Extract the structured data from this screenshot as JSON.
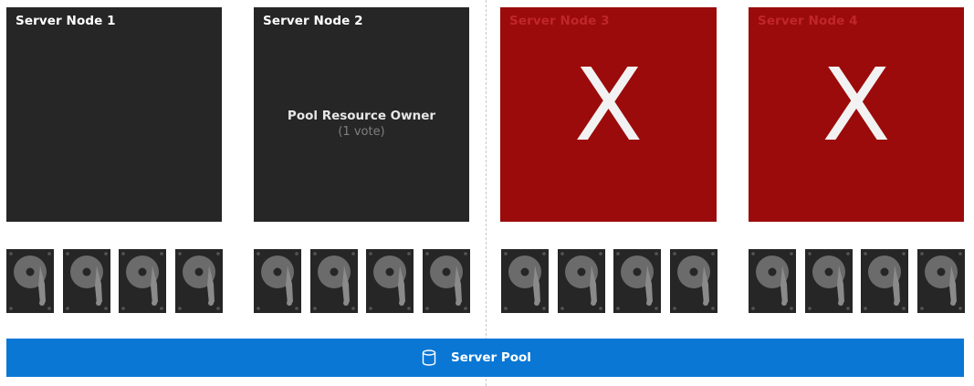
{
  "nodes": [
    {
      "title": "Server Node 1",
      "status": "online"
    },
    {
      "title": "Server Node 2",
      "status": "online",
      "role": "Pool Resource Owner",
      "votes": "(1 vote)"
    },
    {
      "title": "Server Node 3",
      "status": "failed",
      "mark": "X"
    },
    {
      "title": "Server Node 4",
      "status": "failed",
      "mark": "X"
    }
  ],
  "disks_per_node": 4,
  "pool": {
    "label": "Server Pool",
    "icon": "database-icon"
  },
  "colors": {
    "online_node": "#262626",
    "failed_node": "#9b0b0b",
    "failed_title": "#c0262b",
    "pool": "#0a77d5",
    "disk": "#262626"
  }
}
